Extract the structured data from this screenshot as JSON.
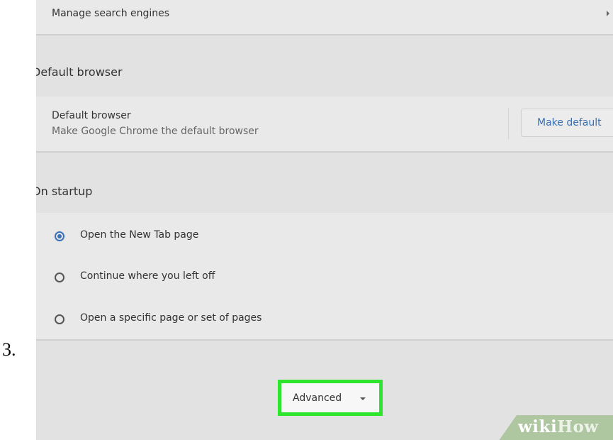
{
  "step": {
    "number": "3."
  },
  "search_engines": {
    "label": "Manage search engines"
  },
  "default_browser": {
    "section_title": "Default browser",
    "row_title": "Default browser",
    "row_subtitle": "Make Google Chrome the default browser",
    "button_label": "Make default"
  },
  "on_startup": {
    "section_title": "On startup",
    "options": [
      {
        "label": "Open the New Tab page",
        "selected": true
      },
      {
        "label": "Continue where you left off",
        "selected": false
      },
      {
        "label": "Open a specific page or set of pages",
        "selected": false
      }
    ]
  },
  "advanced": {
    "label": "Advanced",
    "highlight_color": "#2ee52e"
  },
  "watermark": {
    "part1": "wiki",
    "part2": "How"
  },
  "colors": {
    "accent": "#3a6fb8",
    "page_bg": "#e2e2e2"
  },
  "icons": [
    "chevron-right-icon",
    "radio-checked-icon",
    "radio-unchecked-icon",
    "caret-down-icon"
  ]
}
